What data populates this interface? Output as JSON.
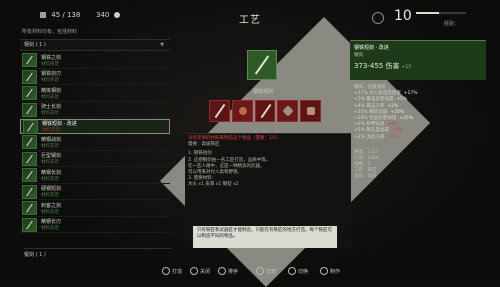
{
  "topbar": {
    "weight": "45 / 138",
    "crowns": "340",
    "title": "工艺",
    "level": "10",
    "level_label": "经验：",
    "xp_progress": 0.45
  },
  "left_panel": {
    "header": "所有材料均有，包括材料",
    "category": "钢剑 ( 1 )",
    "items": [
      {
        "name": "钢铁之剑",
        "sub": "材料充足"
      },
      {
        "name": "钢铁剑刃",
        "sub": "材料充足"
      },
      {
        "name": "精炼钢剑",
        "sub": "材料充足"
      },
      {
        "name": "骑士长剑",
        "sub": "材料充足"
      },
      {
        "name": "钢铁短剑 · 改进",
        "sub": "材料不足",
        "selected": true
      },
      {
        "name": "精钢战剑",
        "sub": "材料充足"
      },
      {
        "name": "巨型钢剑",
        "sub": "材料充足"
      },
      {
        "name": "精钢长剑",
        "sub": "材料充足"
      },
      {
        "name": "硬钢短剑",
        "sub": "材料充足"
      },
      {
        "name": "刺客之剑",
        "sub": "材料充足"
      },
      {
        "name": "精钢长刃",
        "sub": "材料充足"
      }
    ],
    "footer": "银剑 ( 1 )"
  },
  "center_panel": {
    "craft_label": "钢铁短剑",
    "warning": "没有足够的材料来制造这个物品（需要：1/1）",
    "warning2": "需要：高级铁匠",
    "desc_lines": [
      "1. 钢铁短剑",
      "2. 这把钢剑由一名工匠打造，品质中等。",
      "   在一些人眼中，这是一种精良的武器，",
      "   可以用来对付人类和野兽。",
      "3. 需要材料：",
      "   木头 x1  皮革 x1  钢锭 x2"
    ]
  },
  "tooltip": {
    "text": "只有铁匠和武器匠才能制造，只能在有铁匠的地方打造。每个铁匠可以制造不同的物品。"
  },
  "right_panel": {
    "name": "钢铁短剑 · 改进",
    "type": "钢剑",
    "damage": "373-455 伤害",
    "damage_note": "+15",
    "stats": [
      {
        "label": "钢剑，伤害加成",
        "value": "",
        "kind": "section"
      },
      {
        "label": "+17% 对人类造成伤害",
        "value": "+17%",
        "kind": "good"
      },
      {
        "label": "+5% 暴击伤害加成",
        "value": "+5%",
        "kind": "good"
      },
      {
        "label": "+4% 暴击几率",
        "value": "+2%",
        "kind": "good"
      },
      {
        "label": "+20% 精炼武器",
        "value": "+20%",
        "kind": "good"
      },
      {
        "label": "+20% 近战伤害加成",
        "value": "+25%",
        "kind": "good"
      },
      {
        "label": "+2% 护甲穿透",
        "value": "+4%",
        "kind": "bad"
      },
      {
        "label": "+5% 耐久度加成",
        "value": "+5%",
        "kind": "bad"
      },
      {
        "label": "+2% 流血几率",
        "value": "+2%",
        "kind": "bad"
      }
    ],
    "footer_lines": [
      "重量：3.21",
      "价值：1016",
      "插槽：1",
      "工匠：铁匠",
      "等级：高级"
    ]
  },
  "bottom_controls": [
    {
      "key": "A",
      "label": "打造"
    },
    {
      "key": "B",
      "label": "关闭"
    },
    {
      "key": "X",
      "label": "排序"
    },
    {
      "key": "Y",
      "label": "比较"
    },
    {
      "key": "LB",
      "label": "切换"
    },
    {
      "key": "RB",
      "label": "制作"
    }
  ]
}
